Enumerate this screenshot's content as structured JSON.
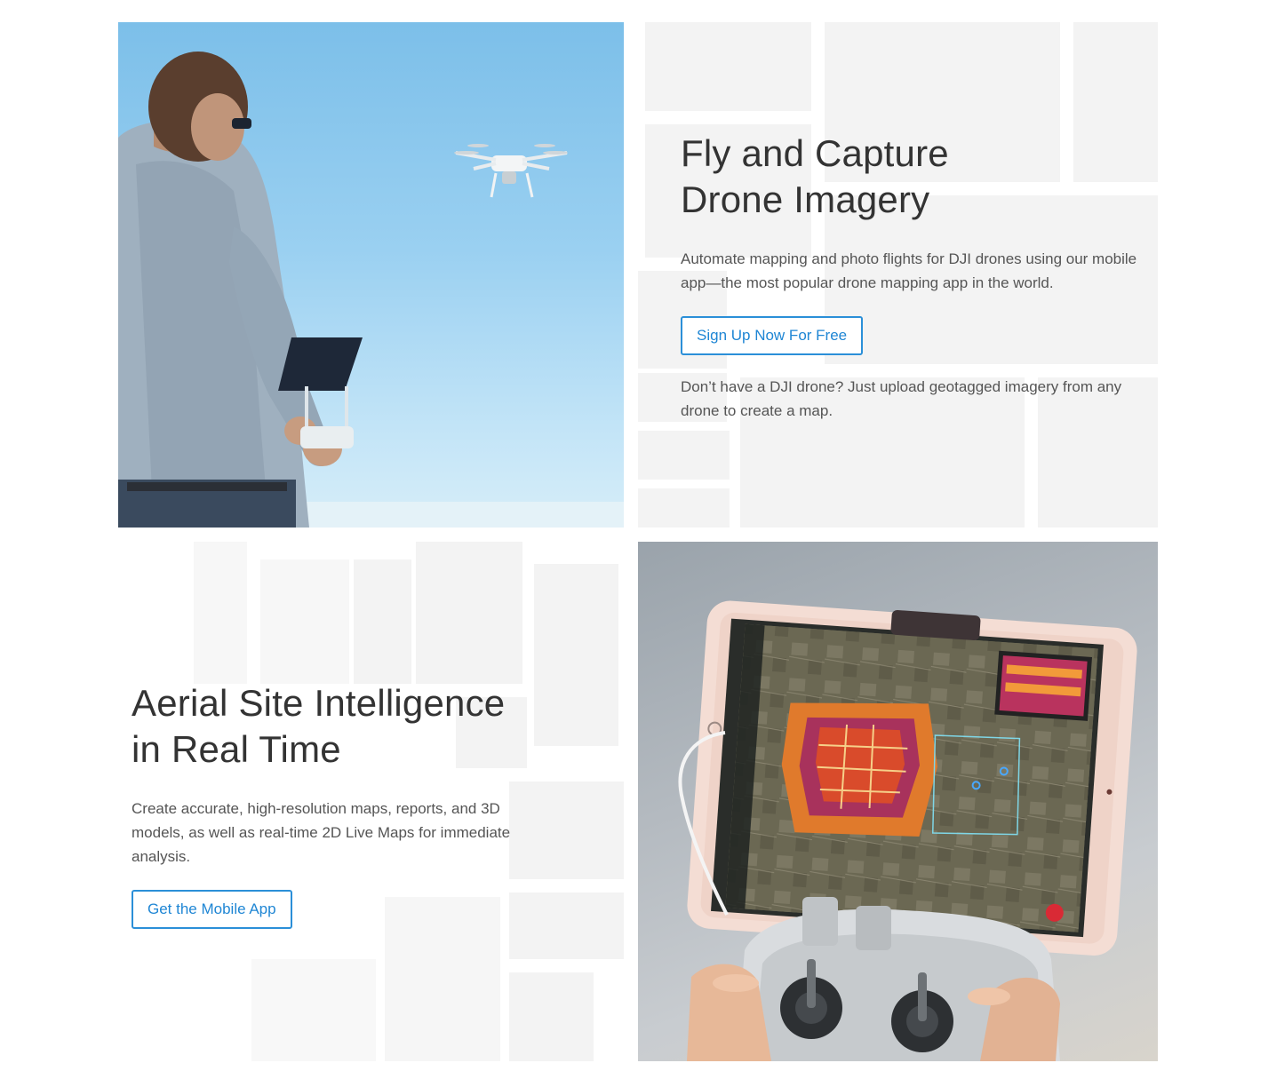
{
  "section_fly": {
    "headline_line1": "Fly and Capture",
    "headline_line2": "Drone Imagery",
    "description": "Automate mapping and photo flights for DJI drones using our mobile app—the most popular drone mapping app in the world.",
    "cta_label": "Sign Up Now For Free",
    "note": "Don’t have a DJI drone? Just upload geotagged imagery from any drone to create a map."
  },
  "section_intel": {
    "headline_line1": "Aerial Site Intelligence",
    "headline_line2": "in Real Time",
    "description": "Create accurate, high-resolution maps, reports, and 3D models, as well as real-time 2D Live Maps for immediate analysis.",
    "cta_label": "Get the Mobile App"
  },
  "images": {
    "drone_pilot": "pilot-flying-drone-photo",
    "tablet_controller": "tablet-on-drone-controller-photo"
  },
  "colors": {
    "accent": "#2b8fd8",
    "text_dark": "#333333",
    "text_body": "#555555",
    "map_block": "#f3f3f3",
    "sky": "#9ad0f1"
  }
}
